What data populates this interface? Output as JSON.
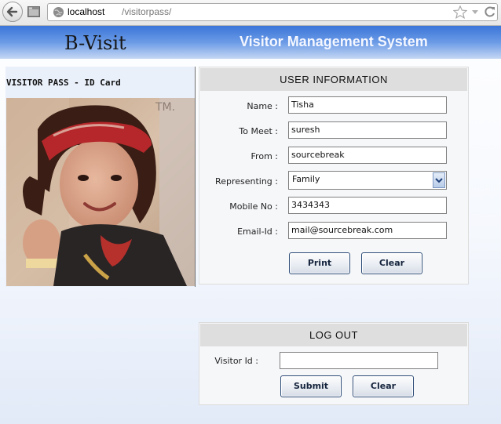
{
  "browser": {
    "url_host": "localhost",
    "url_path": "/visitorpass/"
  },
  "header": {
    "brand": "B-Visit",
    "system_title": "Visitor Management System"
  },
  "pass_card": {
    "title": "VISITOR PASS - ID Card"
  },
  "user_info": {
    "title": "USER INFORMATION",
    "fields": [
      {
        "label": "Name :",
        "value": "Tisha"
      },
      {
        "label": "To Meet :",
        "value": "suresh"
      },
      {
        "label": "From :",
        "value": "sourcebreak"
      },
      {
        "label": "Representing :",
        "value": "Family"
      },
      {
        "label": "Mobile No :",
        "value": "3434343"
      },
      {
        "label": "Email-Id :",
        "value": "mail@sourcebreak.com"
      }
    ],
    "print_label": "Print",
    "clear_label": "Clear"
  },
  "logout": {
    "title": "LOG OUT",
    "visitor_id_label": "Visitor Id :",
    "visitor_id_value": "",
    "submit_label": "Submit",
    "clear_label": "Clear"
  }
}
